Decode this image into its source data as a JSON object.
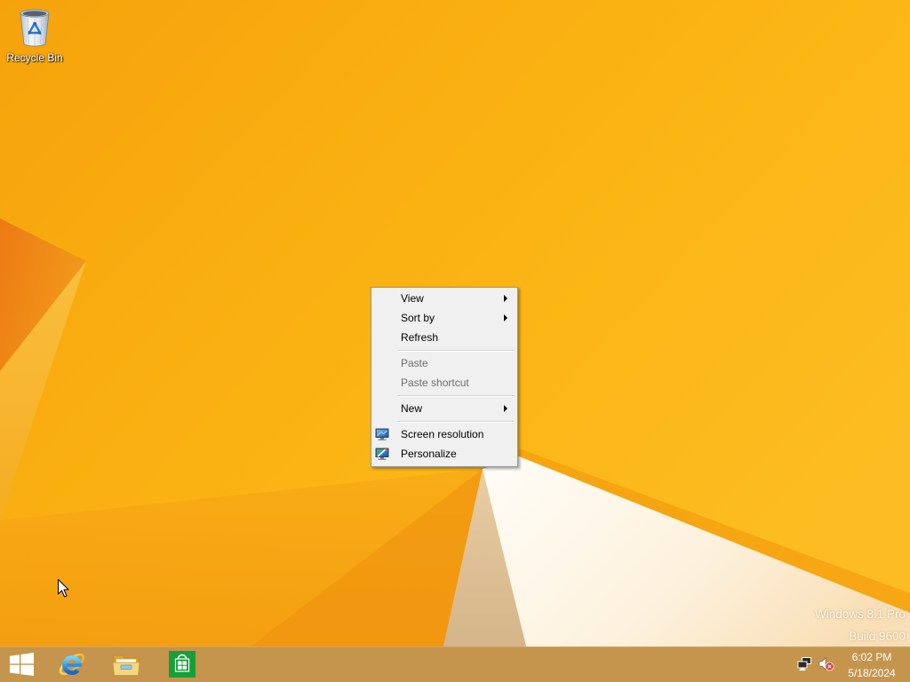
{
  "desktop": {
    "icons": [
      {
        "label": "Recycle Bin",
        "icon": "recycle-bin-icon"
      }
    ]
  },
  "context_menu": {
    "items": [
      {
        "label": "View",
        "submenu": true,
        "enabled": true
      },
      {
        "label": "Sort by",
        "submenu": true,
        "enabled": true
      },
      {
        "label": "Refresh",
        "submenu": false,
        "enabled": true
      },
      {
        "separator": true
      },
      {
        "label": "Paste",
        "submenu": false,
        "enabled": false
      },
      {
        "label": "Paste shortcut",
        "submenu": false,
        "enabled": false
      },
      {
        "separator": true
      },
      {
        "label": "New",
        "submenu": true,
        "enabled": true
      },
      {
        "separator": true
      },
      {
        "label": "Screen resolution",
        "submenu": false,
        "enabled": true,
        "icon": "display-settings-icon"
      },
      {
        "label": "Personalize",
        "submenu": false,
        "enabled": true,
        "icon": "personalize-icon"
      }
    ]
  },
  "watermark": {
    "edition": "Windows 8.1 Pro",
    "build": "Build 9600"
  },
  "taskbar": {
    "start_icon": "windows-start-icon",
    "pinned": [
      {
        "icon": "internet-explorer-icon"
      },
      {
        "icon": "file-explorer-icon"
      },
      {
        "icon": "store-icon"
      }
    ],
    "tray": {
      "icons": [
        "network-icon",
        "volume-muted-icon"
      ],
      "time": "6:02 PM",
      "date": "5/18/2024"
    }
  },
  "cursor": {
    "icon": "mouse-pointer-icon"
  },
  "colors": {
    "wallpaper": "#fbb414",
    "taskbar": "#c5954d",
    "menu_background": "#f0f0f0",
    "menu_border": "#979797",
    "menu_text": "#000000",
    "disabled_text": "#6d6d6d",
    "store_green": "#16a03a"
  }
}
